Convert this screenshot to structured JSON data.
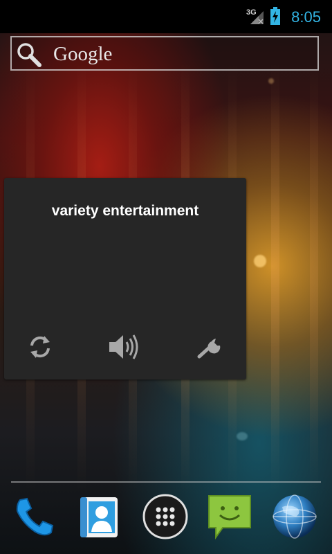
{
  "status_bar": {
    "network_type": "3G",
    "time": "8:05",
    "icons": [
      "signal-icon",
      "battery-charging-icon"
    ],
    "time_color": "#33b5e5"
  },
  "search": {
    "label": "Google",
    "icon": "search-icon"
  },
  "widget": {
    "title": "variety entertainment",
    "buttons": [
      {
        "name": "refresh-button",
        "icon": "refresh-icon"
      },
      {
        "name": "volume-button",
        "icon": "volume-icon"
      },
      {
        "name": "settings-button",
        "icon": "wrench-icon"
      }
    ]
  },
  "dock": {
    "items": [
      {
        "name": "dock-phone",
        "icon": "phone-icon"
      },
      {
        "name": "dock-contacts",
        "icon": "contacts-icon"
      },
      {
        "name": "dock-all-apps",
        "icon": "apps-grid-icon"
      },
      {
        "name": "dock-messaging",
        "icon": "messaging-icon"
      },
      {
        "name": "dock-browser",
        "icon": "globe-icon"
      }
    ]
  }
}
